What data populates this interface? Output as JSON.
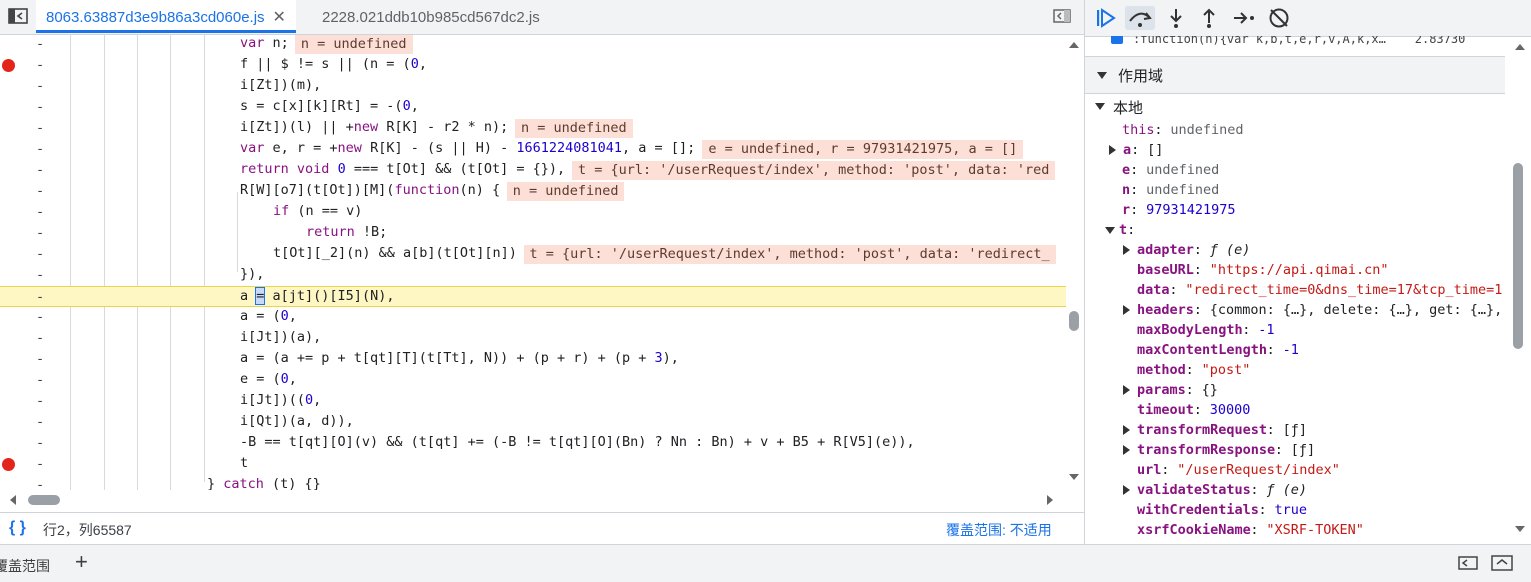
{
  "tabs": [
    {
      "label": "8063.63887d3e9b86a3cd060e.js",
      "active": true
    },
    {
      "label": "2228.021ddb10b985cd567dc2.js",
      "active": false
    }
  ],
  "code_lines": [
    {
      "html": "<span class=\"kw\">var</span> n;",
      "indent": 240,
      "inline": "n = undefined",
      "bp": false
    },
    {
      "html": "f || $ != s || (n = (<span class=\"num\">0</span>,",
      "indent": 240,
      "inline": "",
      "bp": true
    },
    {
      "html": "i[Zt])(m),",
      "indent": 240,
      "inline": "",
      "bp": false
    },
    {
      "html": "s = c[x][k][Rt] = -(<span class=\"num\">0</span>,",
      "indent": 240,
      "inline": "",
      "bp": false
    },
    {
      "html": "i[Zt])(l) || +<span class=\"kw\">new</span> R[K] - r2 * n);",
      "indent": 240,
      "inline": "n = undefined",
      "bp": false
    },
    {
      "html": "<span class=\"kw\">var</span> e, r = +<span class=\"kw\">new</span> R[K] - (s || H) - <span class=\"num\">1661224081041</span>, a = [];",
      "indent": 240,
      "inline": "e = undefined, r = 97931421975, a = []",
      "bp": false
    },
    {
      "html": "<span class=\"kw\">return</span> <span class=\"kw\">void</span> <span class=\"num\">0</span> === t[Ot] && (t[Ot] = {}),",
      "indent": 240,
      "inline": "t = {url: '/userRequest/index', method: 'post', data: 'red",
      "bp": false
    },
    {
      "html": "R[W][o7](t[Ot])[M](<span class=\"kw\">function</span>(n) {",
      "indent": 240,
      "inline": "n = undefined",
      "bp": false
    },
    {
      "html": "<span class=\"kw\">if</span> (n == v)",
      "indent": 273,
      "inline": "",
      "bp": false
    },
    {
      "html": "<span class=\"kw\">return</span> !B;",
      "indent": 306,
      "inline": "",
      "bp": false
    },
    {
      "html": "t[Ot][_2](n) && a[b](t[Ot][n])",
      "indent": 273,
      "inline": "t = {url: '/userRequest/index', method: 'post', data: 'redirect_",
      "bp": false
    },
    {
      "html": "}),",
      "indent": 240,
      "inline": "",
      "bp": false
    },
    {
      "html": "a <span style=\"background:#c6dafc;outline:1px solid #1a73e8\">=</span> a[jt]()[I5](N),",
      "indent": 240,
      "inline": "",
      "bp": false,
      "current": true
    },
    {
      "html": "a = (<span class=\"num\">0</span>,",
      "indent": 240,
      "inline": "",
      "bp": false
    },
    {
      "html": "i[Jt])(a),",
      "indent": 240,
      "inline": "",
      "bp": false
    },
    {
      "html": "a = (a += p + t[qt][T](t[Tt], N)) + (p + r) + (p + <span class=\"num\">3</span>),",
      "indent": 240,
      "inline": "",
      "bp": false
    },
    {
      "html": "e = (<span class=\"num\">0</span>,",
      "indent": 240,
      "inline": "",
      "bp": false
    },
    {
      "html": "i[Jt])((<span class=\"num\">0</span>,",
      "indent": 240,
      "inline": "",
      "bp": false
    },
    {
      "html": "i[Qt])(a, d)),",
      "indent": 240,
      "inline": "",
      "bp": false
    },
    {
      "html": "-B == t[qt][O](v) && (t[qt] += (-B != t[qt][O](Bn) ? Nn : Bn) + v + B5 + R[V5](e)),",
      "indent": 240,
      "inline": "",
      "bp": false
    },
    {
      "html": "t",
      "indent": 240,
      "inline": "",
      "bp": true
    },
    {
      "html": "} <span class=\"kw\">catch</span> (t) {}",
      "indent": 207,
      "inline": "",
      "bp": false
    }
  ],
  "status": {
    "braces": "{ }",
    "position": "行2，列65587",
    "coverage": "覆盖范围: 不适用"
  },
  "callframe_text": ":function(n){var k,b,t,e,r,v,A,k,x…    2.83730",
  "scope": {
    "section_title": "作用域",
    "local_title": "本地",
    "rows": [
      {
        "indent": 37,
        "tri": "",
        "key": "this",
        "keystyle": "plain",
        "val": "undefined",
        "vclass": "v-und"
      },
      {
        "indent": 24,
        "tri": "right",
        "key": "a",
        "keystyle": "bold",
        "val": "[]",
        "vclass": ""
      },
      {
        "indent": 37,
        "tri": "",
        "key": "e",
        "keystyle": "bold",
        "val": "undefined",
        "vclass": "v-und"
      },
      {
        "indent": 37,
        "tri": "",
        "key": "n",
        "keystyle": "bold",
        "val": "undefined",
        "vclass": "v-und"
      },
      {
        "indent": 37,
        "tri": "",
        "key": "r",
        "keystyle": "bold",
        "val": "97931421975",
        "vclass": "v-num"
      },
      {
        "indent": 20,
        "tri": "down",
        "key": "t",
        "keystyle": "bold",
        "val": "",
        "vclass": ""
      },
      {
        "indent": 38,
        "tri": "right",
        "key": "adapter",
        "keystyle": "bold",
        "val": "ƒ (e)",
        "vclass": "v-fn"
      },
      {
        "indent": 52,
        "tri": "",
        "key": "baseURL",
        "keystyle": "bold",
        "val": "\"https://api.qimai.cn\"",
        "vclass": "v-str"
      },
      {
        "indent": 52,
        "tri": "",
        "key": "data",
        "keystyle": "bold",
        "val": "\"redirect_time=0&dns_time=17&tcp_time=1",
        "vclass": "v-str"
      },
      {
        "indent": 38,
        "tri": "right",
        "key": "headers",
        "keystyle": "bold",
        "val": "{common: {…}, delete: {…}, get: {…},",
        "vclass": ""
      },
      {
        "indent": 52,
        "tri": "",
        "key": "maxBodyLength",
        "keystyle": "bold",
        "val": "-1",
        "vclass": "v-num"
      },
      {
        "indent": 52,
        "tri": "",
        "key": "maxContentLength",
        "keystyle": "bold",
        "val": "-1",
        "vclass": "v-num"
      },
      {
        "indent": 52,
        "tri": "",
        "key": "method",
        "keystyle": "bold",
        "val": "\"post\"",
        "vclass": "v-str"
      },
      {
        "indent": 38,
        "tri": "right",
        "key": "params",
        "keystyle": "bold",
        "val": "{}",
        "vclass": ""
      },
      {
        "indent": 52,
        "tri": "",
        "key": "timeout",
        "keystyle": "bold",
        "val": "30000",
        "vclass": "v-num"
      },
      {
        "indent": 38,
        "tri": "right",
        "key": "transformRequest",
        "keystyle": "bold",
        "val": "[ƒ]",
        "vclass": ""
      },
      {
        "indent": 38,
        "tri": "right",
        "key": "transformResponse",
        "keystyle": "bold",
        "val": "[ƒ]",
        "vclass": ""
      },
      {
        "indent": 52,
        "tri": "",
        "key": "url",
        "keystyle": "bold",
        "val": "\"/userRequest/index\"",
        "vclass": "v-str"
      },
      {
        "indent": 38,
        "tri": "right",
        "key": "validateStatus",
        "keystyle": "bold",
        "val": "ƒ (e)",
        "vclass": "v-fn"
      },
      {
        "indent": 52,
        "tri": "",
        "key": "withCredentials",
        "keystyle": "bold",
        "val": "true",
        "vclass": "v-bool"
      },
      {
        "indent": 52,
        "tri": "",
        "key": "xsrfCookieName",
        "keystyle": "bold",
        "val": "\"XSRF-TOKEN\"",
        "vclass": "v-str"
      }
    ]
  },
  "drawer": {
    "tab_label": "覆盖范围",
    "add_label": "+"
  }
}
